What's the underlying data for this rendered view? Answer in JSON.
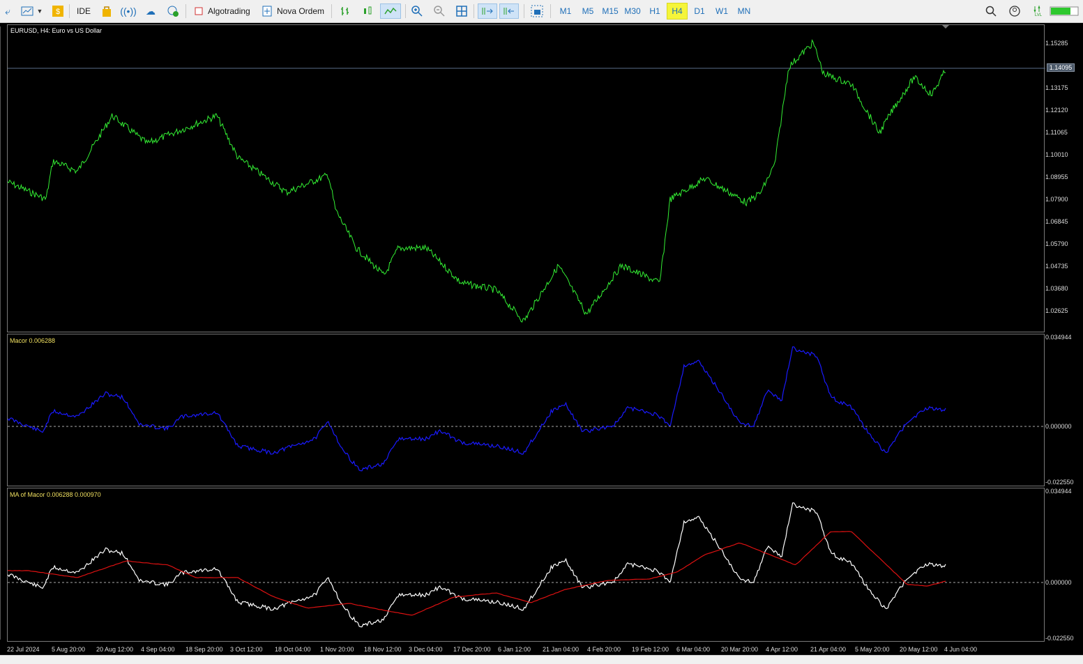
{
  "toolbar": {
    "ide_label": "IDE",
    "algotrading_label": "Algotrading",
    "new_order_label": "Nova Ordem",
    "timeframes": [
      "M1",
      "M5",
      "M15",
      "M30",
      "H1",
      "H4",
      "D1",
      "W1",
      "MN"
    ],
    "active_timeframe": "H4",
    "connection_label": "LVL"
  },
  "main_chart": {
    "title": "EURUSD, H4:  Euro vs US Dollar",
    "price_labels": [
      "1.15285",
      "1.14095",
      "1.13175",
      "1.12120",
      "1.11065",
      "1.10010",
      "1.08955",
      "1.07900",
      "1.06845",
      "1.05790",
      "1.04735",
      "1.03680",
      "1.02625"
    ],
    "current_price": "1.14095",
    "line_color": "#33ee33"
  },
  "macor_pane": {
    "title": "Macor 0.006288",
    "labels": [
      "0.034944",
      "0.000000",
      "-0.022550"
    ],
    "line_color": "#1a1aff"
  },
  "ma_pane": {
    "title": "MA of Macor 0.006288 0.000970",
    "labels": [
      "0.034944",
      "0.000000",
      "-0.022550"
    ],
    "line_color": "#ffffff",
    "ma_color": "#dd1111"
  },
  "time_axis": [
    "22 Jul 2024",
    "5 Aug 20:00",
    "20 Aug 12:00",
    "4 Sep 04:00",
    "18 Sep 20:00",
    "3 Oct 12:00",
    "18 Oct 04:00",
    "1 Nov 20:00",
    "18 Nov 12:00",
    "3 Dec 04:00",
    "17 Dec 20:00",
    "6 Jan 12:00",
    "21 Jan 04:00",
    "4 Feb 20:00",
    "19 Feb 12:00",
    "6 Mar 04:00",
    "20 Mar 20:00",
    "4 Apr 12:00",
    "21 Apr 04:00",
    "5 May 20:00",
    "20 May 12:00",
    "4 Jun 04:00"
  ]
}
